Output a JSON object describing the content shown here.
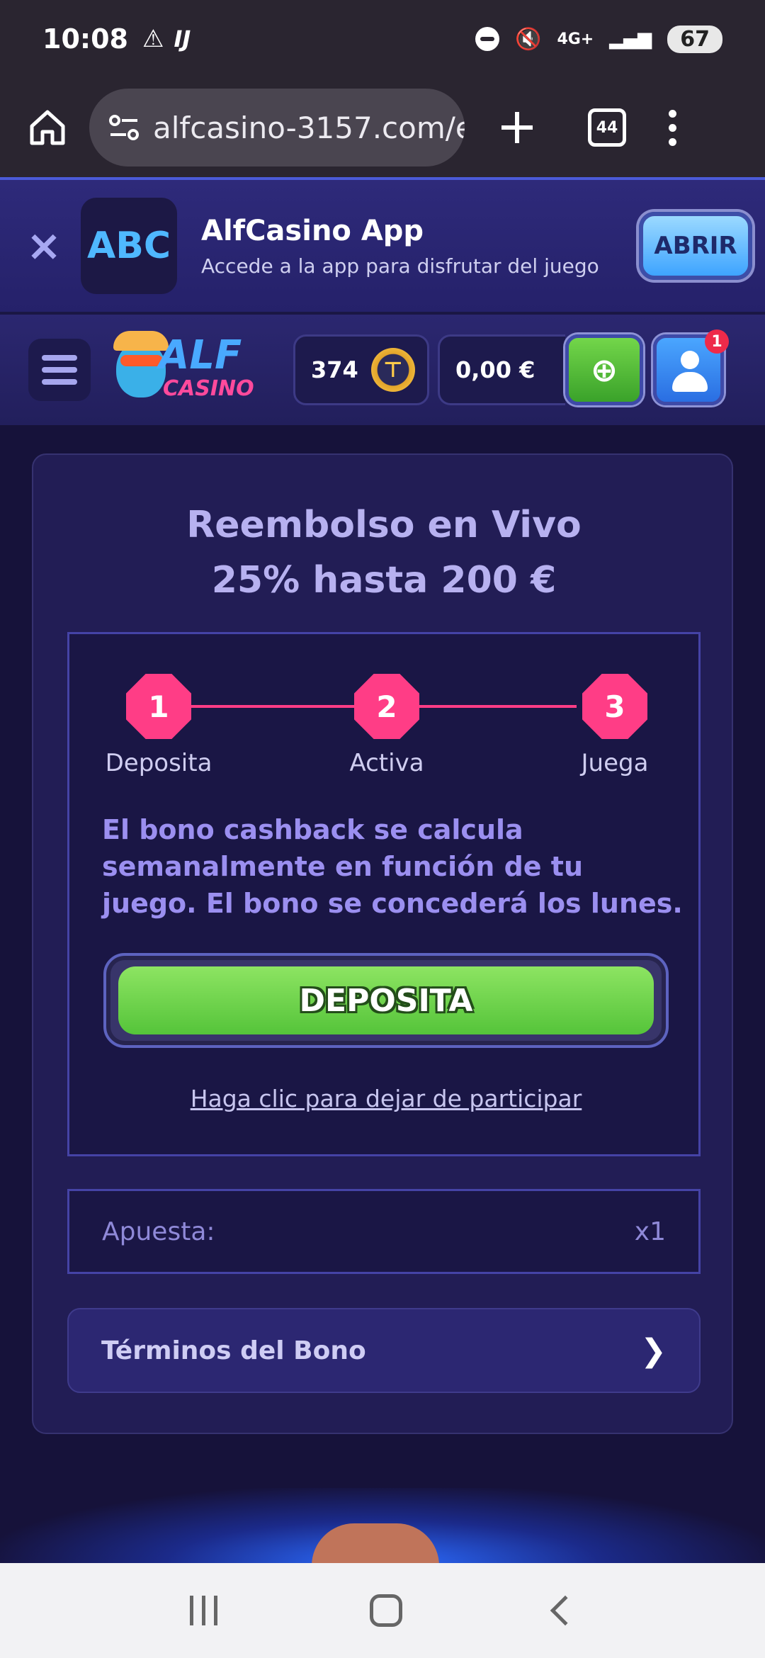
{
  "status_bar": {
    "time": "10:08",
    "network": "4G+",
    "battery": "67"
  },
  "browser": {
    "url": "alfcasino-3157.com/e",
    "tab_count": "44"
  },
  "app_banner": {
    "title": "AlfCasino App",
    "subtitle": "Accede a la app para disfrutar del juego",
    "open_label": "ABRIR",
    "logo_text": "ABC"
  },
  "header": {
    "logo_top": "ALF",
    "logo_bottom": "CASINO",
    "coins": "374",
    "balance": "0,00 €",
    "notification_count": "1"
  },
  "promo": {
    "title_line1": "Reembolso en Vivo",
    "title_line2": "25% hasta 200 €",
    "steps": [
      {
        "number": "1",
        "label": "Deposita"
      },
      {
        "number": "2",
        "label": "Activa"
      },
      {
        "number": "3",
        "label": "Juega"
      }
    ],
    "description": "El bono cashback se calcula semanalmente en función de tu juego. El bono se concederá los lunes.",
    "deposit_button": "DEPOSITA",
    "optout_link": "Haga clic para dejar de participar",
    "wager_label": "Apuesta:",
    "wager_value": "x1",
    "terms_label": "Términos del Bono"
  },
  "colors": {
    "accent_pink": "#ff3d86",
    "deposit_green": "#55c43a",
    "background": "#16123a"
  }
}
